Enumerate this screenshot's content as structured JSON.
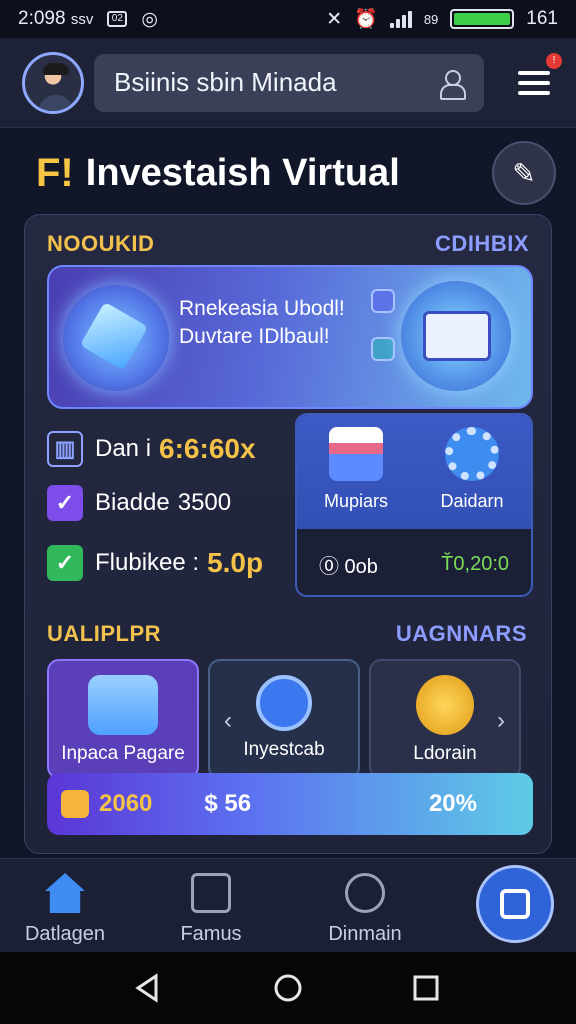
{
  "status_bar": {
    "time": "2:098",
    "carrier": "ssv",
    "notif_box": "02",
    "network": "89",
    "battery": "161"
  },
  "header": {
    "search_text": "Bsiinis sbin Minada"
  },
  "title": {
    "logo": "F!",
    "text": "Investaish Virtual"
  },
  "overview": {
    "label": "NOOUKID",
    "link": "CDIHBIX",
    "banner_line1": "Rnekeasia Ubodl!",
    "banner_line2": "Duvtare IDlbaul!"
  },
  "stats": [
    {
      "label": "Dan i",
      "value": "6:6:60x",
      "color": "#f3c247"
    },
    {
      "label": "Biadde",
      "value": "3500",
      "color": "#ffffff"
    },
    {
      "label": "Flubikee :",
      "value": "5.0p",
      "color": "#f3c247"
    }
  ],
  "tools": {
    "item1": "Mupiars",
    "item2": "Daidarn",
    "left_value": "⓪ 0ob",
    "right_value": "Ť0,20:0"
  },
  "quick": {
    "label": "UALIPLPR",
    "link": "UAGNNARS",
    "tiles": [
      "Inpaca Pagare",
      "Inyestcab",
      "Ldorain"
    ]
  },
  "progress": {
    "left": "2060",
    "middle": "$ 56",
    "right": "20%",
    "fill_percent": 20
  },
  "bottom_nav": {
    "item1": "Datlagen",
    "item2": "Famus",
    "item3": "Dinmain"
  },
  "colors": {
    "accent": "#f3c247",
    "link": "#8c9cff",
    "primary": "#2f63d8"
  }
}
